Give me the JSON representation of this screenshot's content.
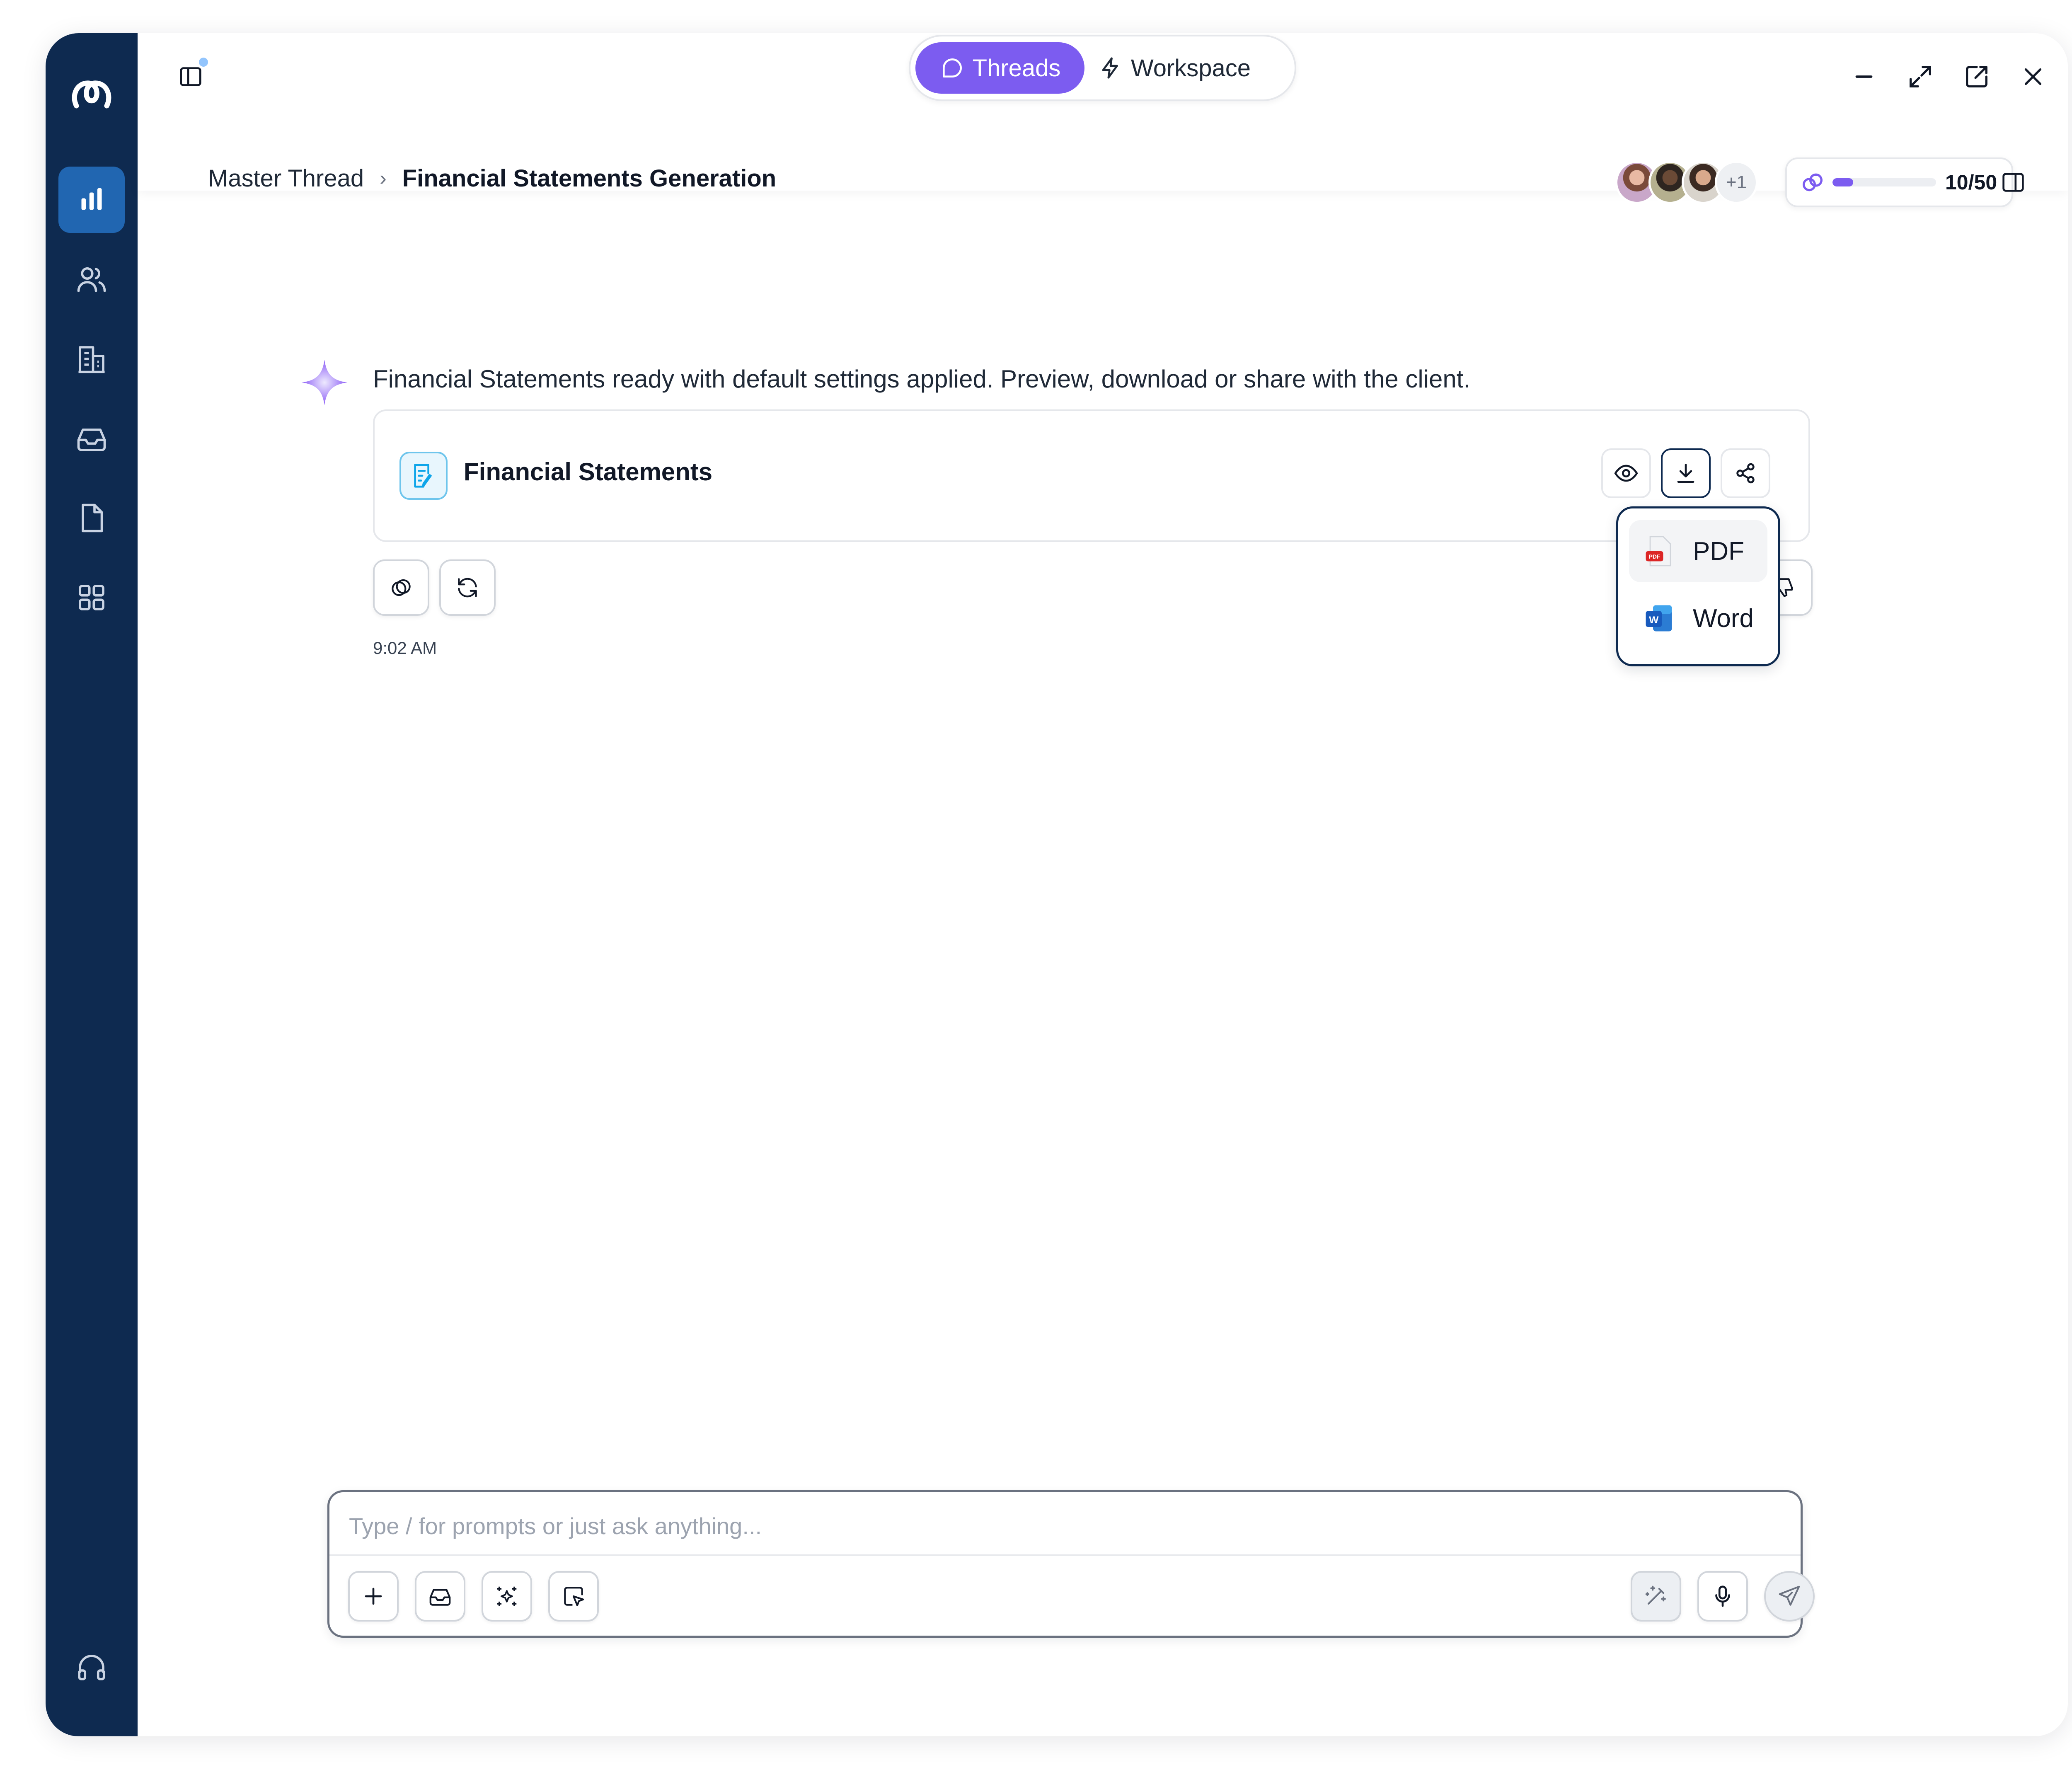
{
  "header": {
    "tabs": [
      {
        "label": "Threads",
        "icon": "chat-icon",
        "active": true
      },
      {
        "label": "Workspace",
        "icon": "lightning-icon",
        "active": false
      }
    ],
    "breadcrumb": {
      "parent": "Master Thread",
      "current": "Financial Statements Generation"
    },
    "collaborators": {
      "extra_count": "+1"
    },
    "credits": {
      "label": "10/50",
      "used": 10,
      "total": 50
    }
  },
  "sidebar": {
    "items": [
      {
        "name": "analytics",
        "icon": "bar-chart-icon",
        "active": true
      },
      {
        "name": "people",
        "icon": "users-icon"
      },
      {
        "name": "organizations",
        "icon": "building-icon"
      },
      {
        "name": "inbox",
        "icon": "inbox-icon"
      },
      {
        "name": "documents",
        "icon": "document-icon"
      },
      {
        "name": "apps",
        "icon": "grid-icon"
      },
      {
        "name": "support",
        "icon": "headphones-icon"
      }
    ]
  },
  "message": {
    "text": "Financial Statements ready with default settings applied. Preview, download or share with the client.",
    "time": "9:02 AM",
    "card": {
      "title": "Financial Statements"
    }
  },
  "download_menu": {
    "items": [
      {
        "label": "PDF",
        "icon": "pdf-file-icon"
      },
      {
        "label": "Word",
        "icon": "word-file-icon"
      }
    ]
  },
  "composer": {
    "placeholder": "Type / for prompts or just ask anything..."
  },
  "colors": {
    "sidebar_bg": "#0e2a50",
    "accent": "#7c5cf0",
    "sidebar_active": "#2166b1"
  }
}
